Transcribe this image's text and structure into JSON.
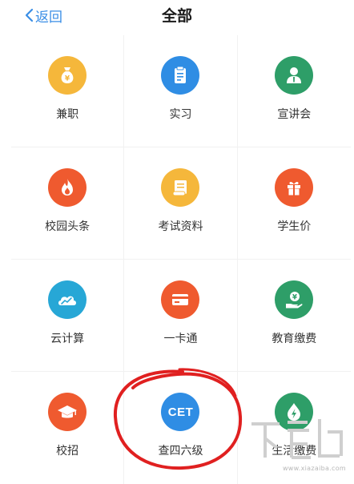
{
  "nav": {
    "back_label": "返回",
    "title": "全部"
  },
  "items": [
    {
      "label": "兼职",
      "icon": "money-bag-icon",
      "color": "#f5b73b"
    },
    {
      "label": "实习",
      "icon": "clipboard-icon",
      "color": "#2f8de4"
    },
    {
      "label": "宣讲会",
      "icon": "presenter-icon",
      "color": "#2e9e68"
    },
    {
      "label": "校园头条",
      "icon": "flame-icon",
      "color": "#ef5a2f"
    },
    {
      "label": "考试资料",
      "icon": "scroll-document-icon",
      "color": "#f5b73b"
    },
    {
      "label": "学生价",
      "icon": "gift-icon",
      "color": "#ef5a2f"
    },
    {
      "label": "云计算",
      "icon": "cloud-chart-icon",
      "color": "#27a7d6"
    },
    {
      "label": "一卡通",
      "icon": "card-icon",
      "color": "#ef5a2f"
    },
    {
      "label": "教育缴费",
      "icon": "hand-money-icon",
      "color": "#2e9e68"
    },
    {
      "label": "校招",
      "icon": "graduation-cap-icon",
      "color": "#ef5a2f"
    },
    {
      "label": "查四六级",
      "icon": "cet-icon",
      "color": "#2f8de4",
      "icon_text": "CET"
    },
    {
      "label": "生活缴费",
      "icon": "water-drop-bolt-icon",
      "color": "#2e9e68"
    }
  ],
  "watermark": {
    "url": "www.xiazaiba.com"
  },
  "colors": {
    "accent": "#3a8ee6",
    "highlight_circle": "#e02020"
  }
}
